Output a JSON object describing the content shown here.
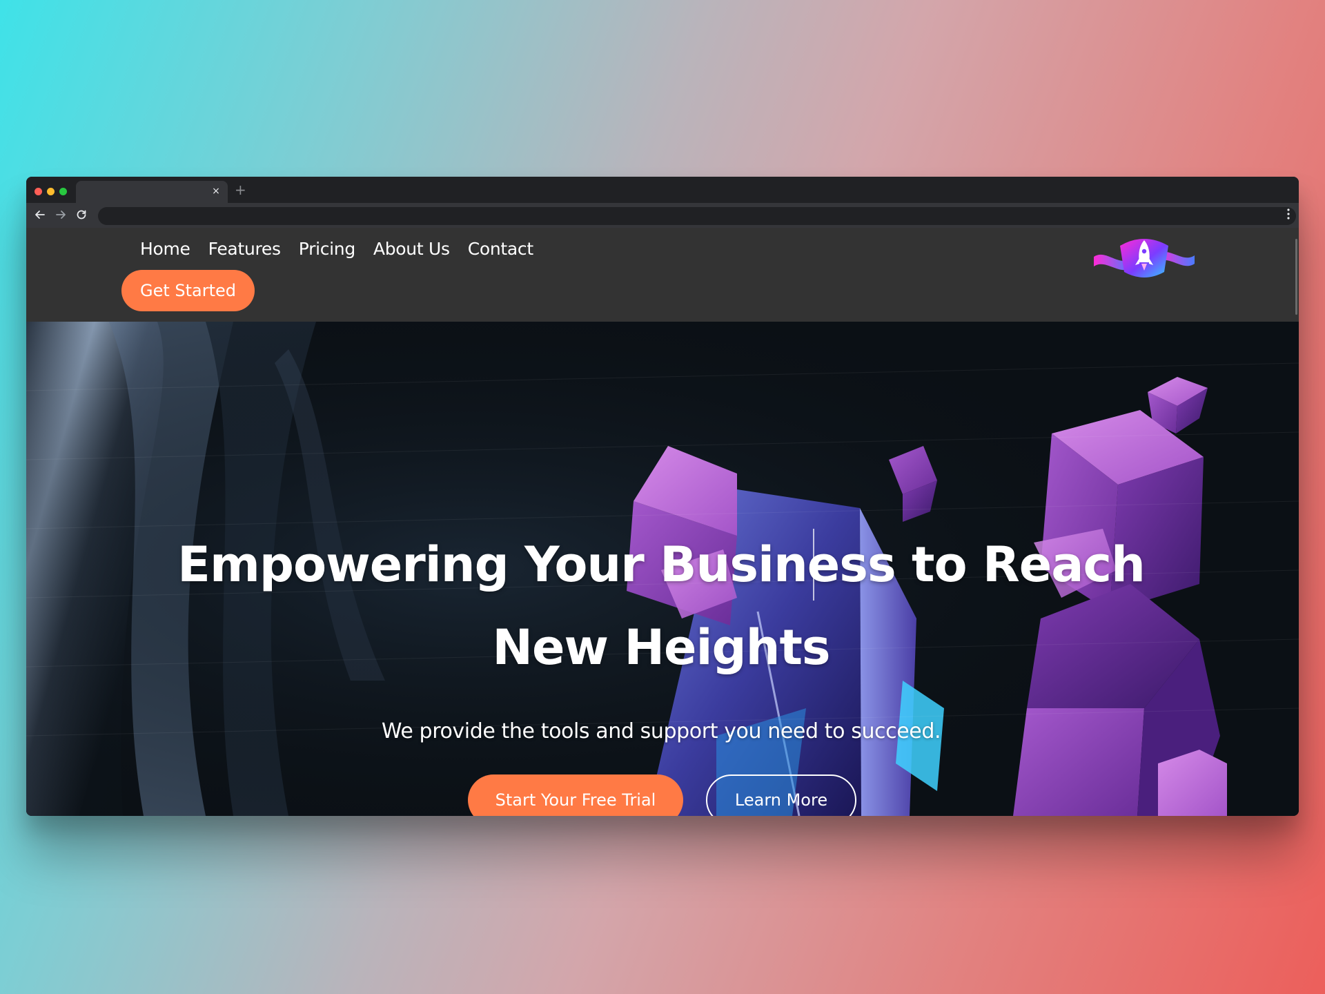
{
  "browser": {
    "tab_close": "×",
    "new_tab": "+"
  },
  "nav": {
    "links": [
      "Home",
      "Features",
      "Pricing",
      "About Us",
      "Contact"
    ],
    "cta": "Get Started"
  },
  "hero": {
    "title_line1": "Empowering Your Business to Reach",
    "title_line2": "New Heights",
    "subtitle": "We provide the tools and support you need to succeed.",
    "primary_cta": "Start Your Free Trial",
    "secondary_cta": "Learn More"
  },
  "colors": {
    "accent": "#ff7a45",
    "header_bg": "#333333",
    "cube_purple": "#9b4fc8"
  },
  "icons": {
    "back": "arrow-left-icon",
    "forward": "arrow-right-icon",
    "reload": "reload-icon",
    "menu": "kebab-menu-icon",
    "logo": "rocket-logo"
  }
}
